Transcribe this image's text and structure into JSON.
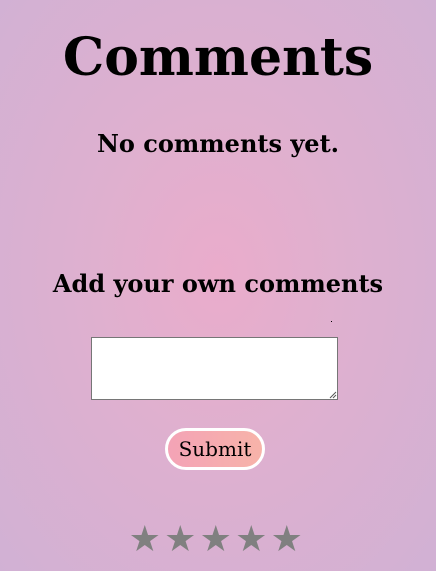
{
  "comments": {
    "title": "Comments",
    "empty_message": "No comments yet."
  },
  "form": {
    "heading": "Add your own comments",
    "textarea_value": "",
    "submit_label": "Submit"
  },
  "rating": {
    "max": 5,
    "value": 0,
    "star_glyph": "★",
    "star_color": "#808080"
  },
  "colors": {
    "background_center": "#eaaccb",
    "background_edge": "#d1b1d4",
    "button_gradient_start": "#f4a3b6",
    "button_gradient_end": "#f7b3a9"
  }
}
